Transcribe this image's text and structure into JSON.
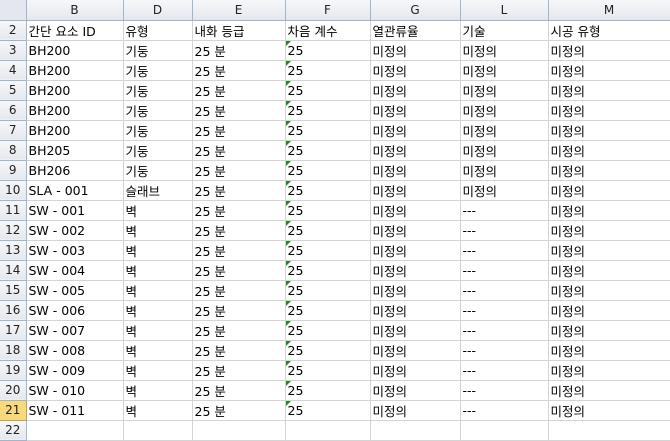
{
  "columns": [
    "B",
    "D",
    "E",
    "F",
    "G",
    "L",
    "M"
  ],
  "selected_row": 21,
  "rows": [
    {
      "n": 2,
      "cells": [
        "간단 요소 ID",
        "유형",
        "내화 등급",
        "차음 계수",
        "열관류율",
        "기술",
        "시공 유형"
      ]
    },
    {
      "n": 3,
      "cells": [
        "BH200",
        "기둥",
        "25 분",
        "25",
        "미정의",
        "미정의",
        "미정의"
      ]
    },
    {
      "n": 4,
      "cells": [
        "BH200",
        "기둥",
        "25 분",
        "25",
        "미정의",
        "미정의",
        "미정의"
      ]
    },
    {
      "n": 5,
      "cells": [
        "BH200",
        "기둥",
        "25 분",
        "25",
        "미정의",
        "미정의",
        "미정의"
      ]
    },
    {
      "n": 6,
      "cells": [
        "BH200",
        "기둥",
        "25 분",
        "25",
        "미정의",
        "미정의",
        "미정의"
      ]
    },
    {
      "n": 7,
      "cells": [
        "BH200",
        "기둥",
        "25 분",
        "25",
        "미정의",
        "미정의",
        "미정의"
      ]
    },
    {
      "n": 8,
      "cells": [
        "BH205",
        "기둥",
        "25 분",
        "25",
        "미정의",
        "미정의",
        "미정의"
      ]
    },
    {
      "n": 9,
      "cells": [
        "BH206",
        "기둥",
        "25 분",
        "25",
        "미정의",
        "미정의",
        "미정의"
      ]
    },
    {
      "n": 10,
      "cells": [
        "SLA - 001",
        "슬래브",
        "25 분",
        "25",
        "미정의",
        "미정의",
        "미정의"
      ]
    },
    {
      "n": 11,
      "cells": [
        "SW - 001",
        "벽",
        "25 분",
        "25",
        "미정의",
        "---",
        "미정의"
      ]
    },
    {
      "n": 12,
      "cells": [
        "SW - 002",
        "벽",
        "25 분",
        "25",
        "미정의",
        "---",
        "미정의"
      ]
    },
    {
      "n": 13,
      "cells": [
        "SW - 003",
        "벽",
        "25 분",
        "25",
        "미정의",
        "---",
        "미정의"
      ]
    },
    {
      "n": 14,
      "cells": [
        "SW - 004",
        "벽",
        "25 분",
        "25",
        "미정의",
        "---",
        "미정의"
      ]
    },
    {
      "n": 15,
      "cells": [
        "SW - 005",
        "벽",
        "25 분",
        "25",
        "미정의",
        "---",
        "미정의"
      ]
    },
    {
      "n": 16,
      "cells": [
        "SW - 006",
        "벽",
        "25 분",
        "25",
        "미정의",
        "---",
        "미정의"
      ]
    },
    {
      "n": 17,
      "cells": [
        "SW - 007",
        "벽",
        "25 분",
        "25",
        "미정의",
        "---",
        "미정의"
      ]
    },
    {
      "n": 18,
      "cells": [
        "SW - 008",
        "벽",
        "25 분",
        "25",
        "미정의",
        "---",
        "미정의"
      ]
    },
    {
      "n": 19,
      "cells": [
        "SW - 009",
        "벽",
        "25 분",
        "25",
        "미정의",
        "---",
        "미정의"
      ]
    },
    {
      "n": 20,
      "cells": [
        "SW - 010",
        "벽",
        "25 분",
        "25",
        "미정의",
        "---",
        "미정의"
      ]
    },
    {
      "n": 21,
      "cells": [
        "SW - 011",
        "벽",
        "25 분",
        "25",
        "미정의",
        "---",
        "미정의"
      ]
    },
    {
      "n": 22,
      "cells": [
        "",
        "",
        "",
        "",
        "",
        "",
        ""
      ]
    }
  ]
}
